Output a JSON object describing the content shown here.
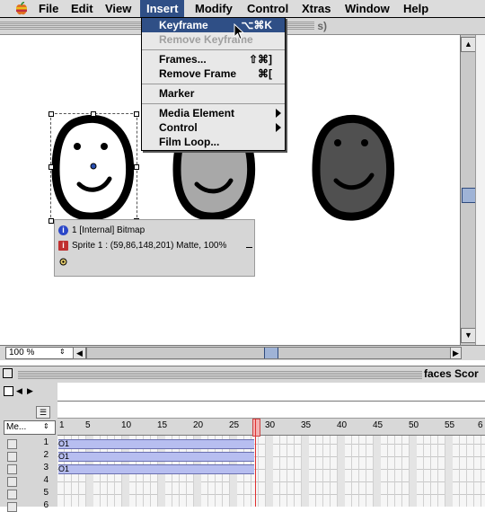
{
  "menubar": {
    "apple_icon": "apple-icon",
    "items": [
      "File",
      "Edit",
      "View",
      "Insert",
      "Modify",
      "Control",
      "Xtras",
      "Window",
      "Help"
    ],
    "active": "Insert"
  },
  "insert_menu": {
    "items": [
      {
        "label": "Keyframe",
        "shortcut": "⌥⌘K",
        "highlighted": true
      },
      {
        "label": "Remove Keyframe",
        "shortcut": "",
        "disabled": true
      },
      {
        "label": "Frames...",
        "shortcut": "⇧⌘]"
      },
      {
        "label": "Remove Frame",
        "shortcut": "⌘["
      },
      {
        "label": "Marker",
        "shortcut": ""
      },
      {
        "label": "Media Element",
        "submenu": true
      },
      {
        "label": "Control",
        "submenu": true
      },
      {
        "label": "Film Loop...",
        "shortcut": ""
      }
    ]
  },
  "stage": {
    "title_partial": "s)",
    "zoom": "100 %",
    "sprite_overlay": {
      "cast_line": "1 [Internal] Bitmap",
      "sprite_line": "Sprite 1 : (59,86,148,201) Matte, 100%"
    }
  },
  "score": {
    "title": "faces Scor",
    "channel_popup": "Me...",
    "frame_ticks": [
      "1",
      "5",
      "10",
      "15",
      "20",
      "25",
      "30",
      "35",
      "40",
      "45",
      "50",
      "55",
      "6"
    ],
    "channels": [
      "1",
      "2",
      "3",
      "4",
      "5",
      "6"
    ],
    "sprite_spans": [
      {
        "channel": "1",
        "label": "O1"
      },
      {
        "channel": "2",
        "label": "O1"
      },
      {
        "channel": "3",
        "label": "O1"
      }
    ],
    "playhead_frame": 28
  },
  "colors": {
    "highlight": "#2f4f86",
    "sprite_bar": "#b7bef0",
    "playhead": "#e03030"
  }
}
